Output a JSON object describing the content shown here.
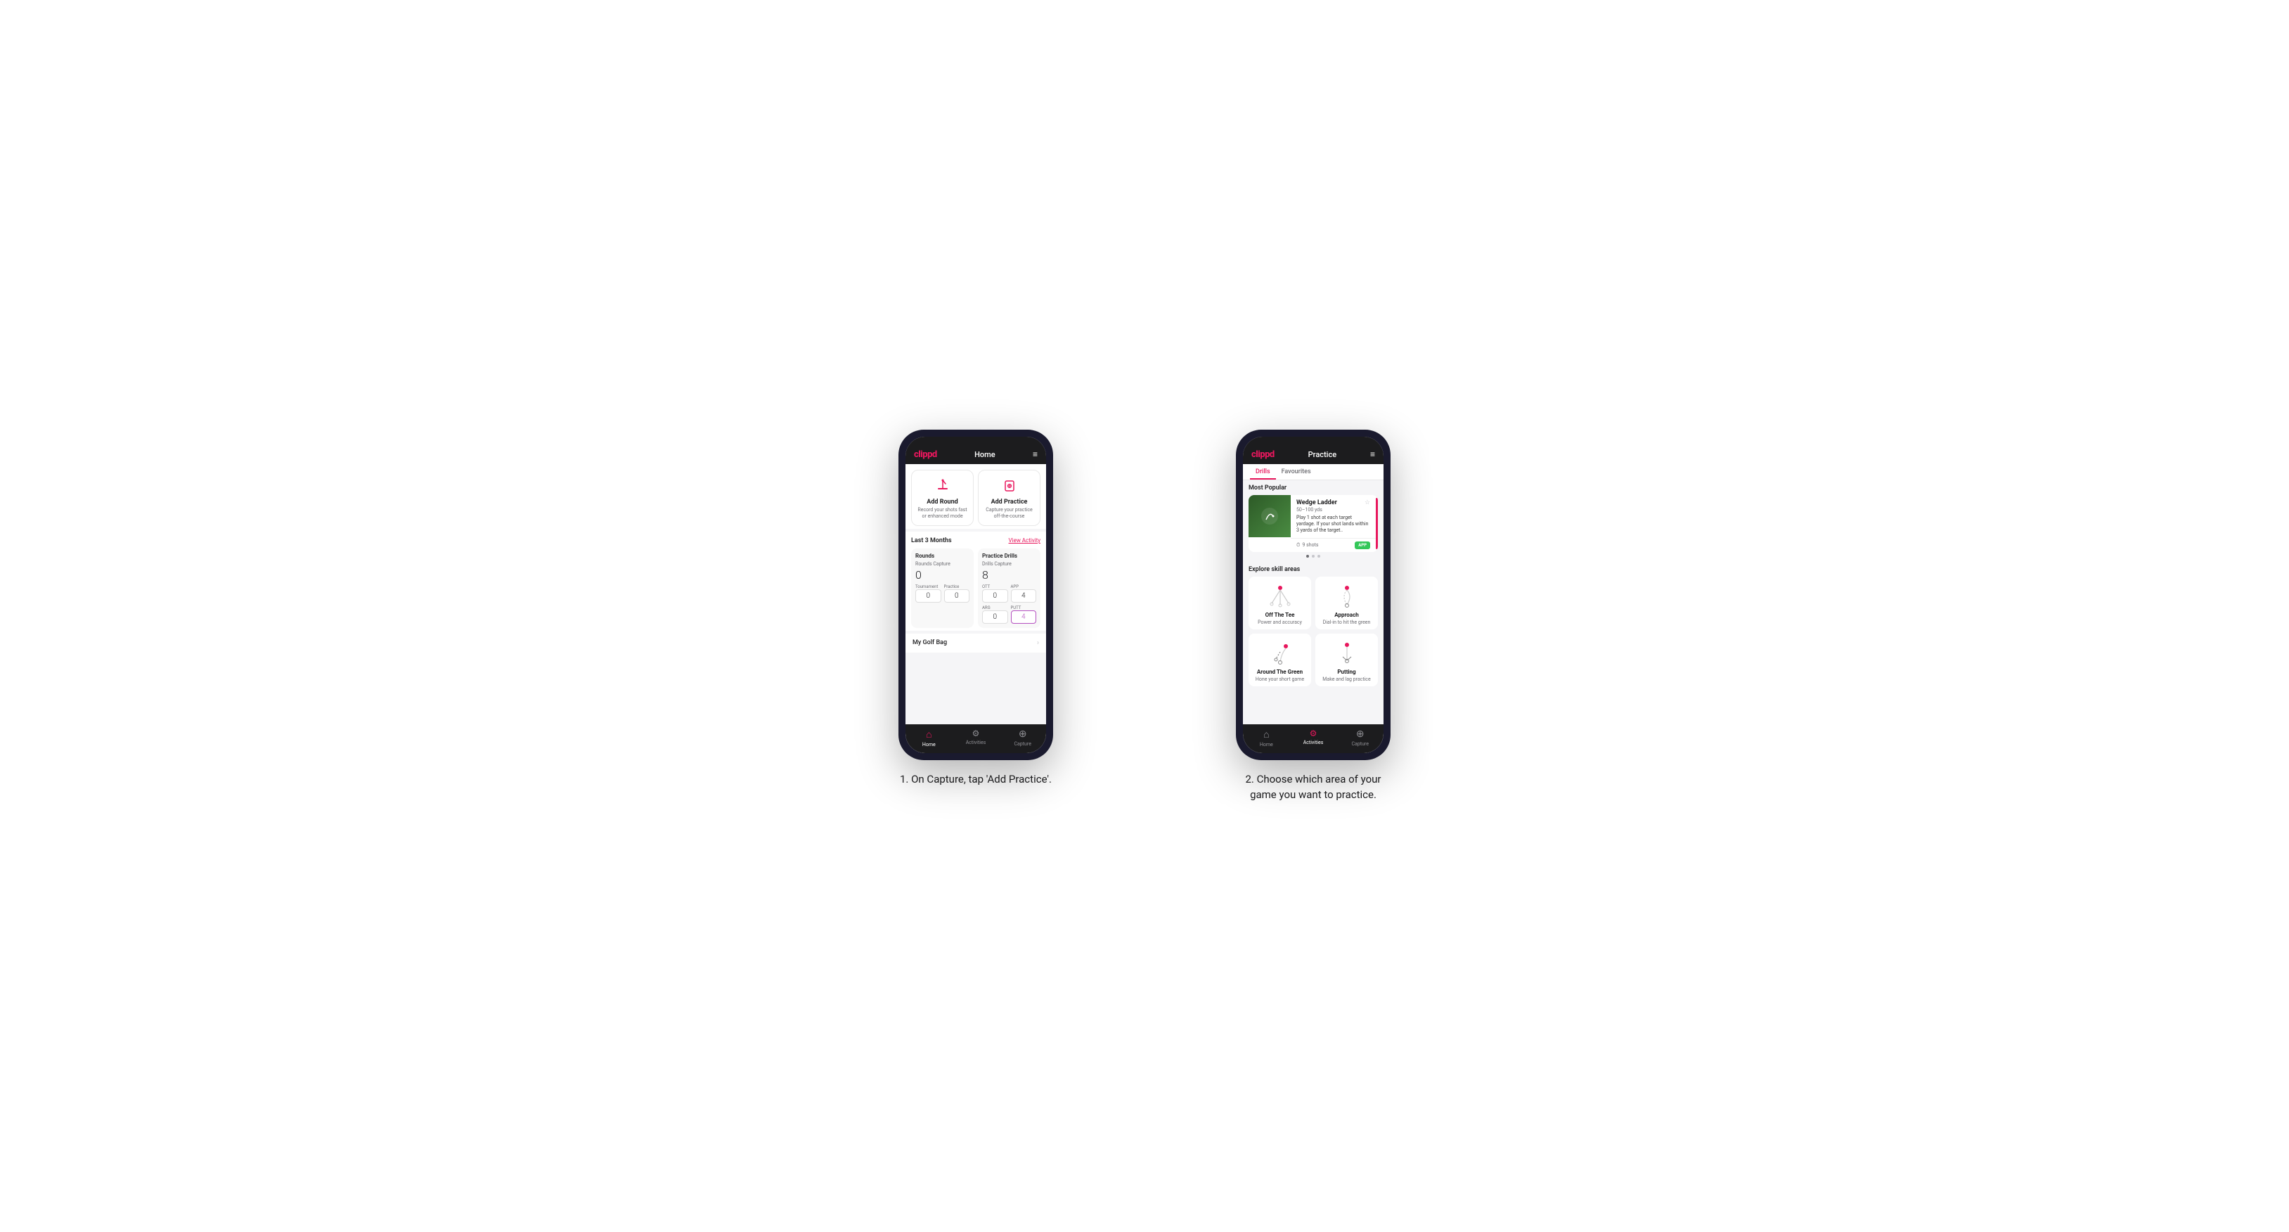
{
  "phone1": {
    "header": {
      "logo": "clippd",
      "title": "Home",
      "menu_icon": "≡"
    },
    "add_round": {
      "title": "Add Round",
      "description": "Record your shots fast or enhanced mode"
    },
    "add_practice": {
      "title": "Add Practice",
      "description": "Capture your practice off-the-course"
    },
    "stats": {
      "period": "Last 3 Months",
      "view_activity": "View Activity",
      "rounds_label": "Rounds",
      "rounds_capture_label": "Rounds Capture",
      "rounds_value": "0",
      "tournament_label": "Tournament",
      "tournament_value": "0",
      "practice_label": "Practice",
      "practice_value": "0",
      "drills_label": "Practice Drills",
      "drills_capture_label": "Drills Capture",
      "drills_value": "8",
      "ott_label": "OTT",
      "ott_value": "0",
      "app_label": "APP",
      "app_value": "4",
      "arg_label": "ARG",
      "arg_value": "0",
      "putt_label": "PUTT",
      "putt_value": "4"
    },
    "golf_bag": "My Golf Bag",
    "nav": {
      "home": "Home",
      "activities": "Activities",
      "capture": "Capture"
    }
  },
  "phone2": {
    "header": {
      "logo": "clippd",
      "title": "Practice",
      "menu_icon": "≡"
    },
    "tabs": {
      "drills": "Drills",
      "favourites": "Favourites"
    },
    "featured_section": {
      "title": "Most Popular",
      "card_title": "Wedge Ladder",
      "card_yardage": "50–100 yds",
      "card_desc": "Play 1 shot at each target yardage. If your shot lands within 3 yards of the target..",
      "shots": "9 shots",
      "badge": "APP"
    },
    "explore": {
      "title": "Explore skill areas",
      "off_the_tee": {
        "title": "Off The Tee",
        "desc": "Power and accuracy"
      },
      "approach": {
        "title": "Approach",
        "desc": "Dial-in to hit the green"
      },
      "around_the_green": {
        "title": "Around The Green",
        "desc": "Hone your short game"
      },
      "putting": {
        "title": "Putting",
        "desc": "Make and lag practice"
      }
    },
    "nav": {
      "home": "Home",
      "activities": "Activities",
      "capture": "Capture"
    }
  },
  "captions": {
    "step1": "1. On Capture, tap 'Add Practice'.",
    "step2": "2. Choose which area of your game you want to practice."
  },
  "colors": {
    "brand_pink": "#e8175d",
    "dark_bg": "#1c1c1e",
    "green_badge": "#34c759",
    "purple_highlight": "#b44fc0"
  }
}
